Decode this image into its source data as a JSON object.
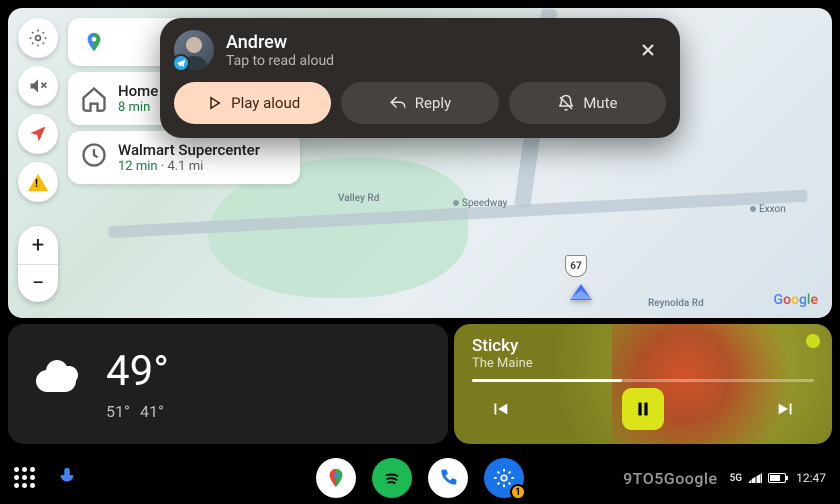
{
  "map": {
    "roads": {
      "valley": "Valley Rd",
      "reynolda": "Reynolda Rd"
    },
    "shield": "67",
    "pois": {
      "speedway": "Speedway",
      "exxon": "Exxon"
    },
    "logo_chars": [
      "G",
      "o",
      "o",
      "g",
      "l",
      "e"
    ]
  },
  "destinations": [
    {
      "title": "Home",
      "time": "8 min",
      "icon": "home"
    },
    {
      "title": "Walmart Supercenter",
      "time": "12 min",
      "dist": "4.1 mi",
      "icon": "history"
    }
  ],
  "notification": {
    "sender": "Andrew",
    "subtitle": "Tap to read aloud",
    "actions": {
      "play": "Play aloud",
      "reply": "Reply",
      "mute": "Mute"
    },
    "app": "telegram"
  },
  "weather": {
    "temp": "49°",
    "high": "51°",
    "low": "41°"
  },
  "media": {
    "title": "Sticky",
    "artist": "The Maine",
    "progress_pct": 44,
    "app": "spotify"
  },
  "dock": {
    "apps": [
      "maps",
      "spotify",
      "phone",
      "settings"
    ],
    "settings_badge": "1"
  },
  "status": {
    "net": "5G",
    "time": "12:47"
  },
  "watermark": "9TO5Google"
}
